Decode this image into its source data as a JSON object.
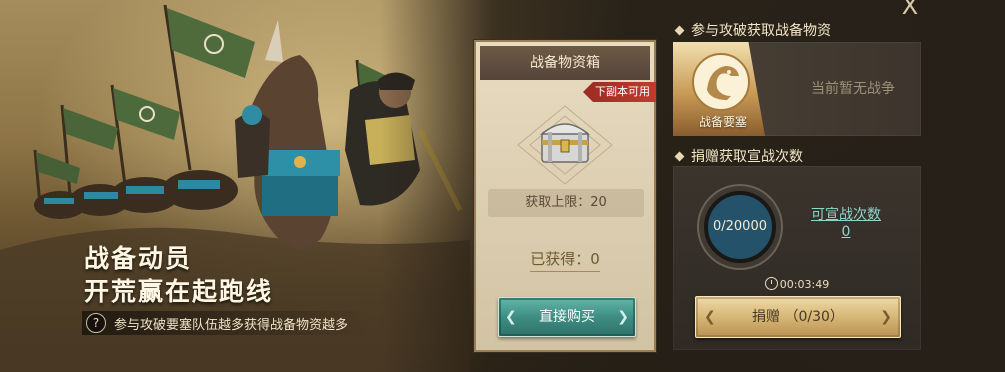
{
  "close_label": "X",
  "slogan": {
    "line1": "战备动员",
    "line2": "开荒赢在起跑线",
    "tip": "参与攻破要塞队伍越多获得战备物资越多",
    "tip_icon": "?"
  },
  "crate": {
    "title": "战备物资箱",
    "tag": "下副本可用",
    "limit": "获取上限：20",
    "obtained": "已获得：0",
    "buy_label": "直接购买",
    "icon": "treasure-chest-icon"
  },
  "fortress": {
    "header": "参与攻破获取战备物资",
    "card_label": "战备要塞",
    "status": "当前暂无战争",
    "icon": "eagle-emblem-icon"
  },
  "donate": {
    "header": "捐赠获取宣战次数",
    "progress_text": "0/20000",
    "progress_fraction": 0,
    "declare_label": "可宣战次数",
    "declare_value": "0",
    "timer": "00:03:49",
    "button_label": "捐赠 （0/30）"
  },
  "colors": {
    "teal_button": "#3e8d83",
    "gold_button": "#d6b777",
    "tag_red": "#c23b2e",
    "link_teal": "#8fd6cd"
  }
}
